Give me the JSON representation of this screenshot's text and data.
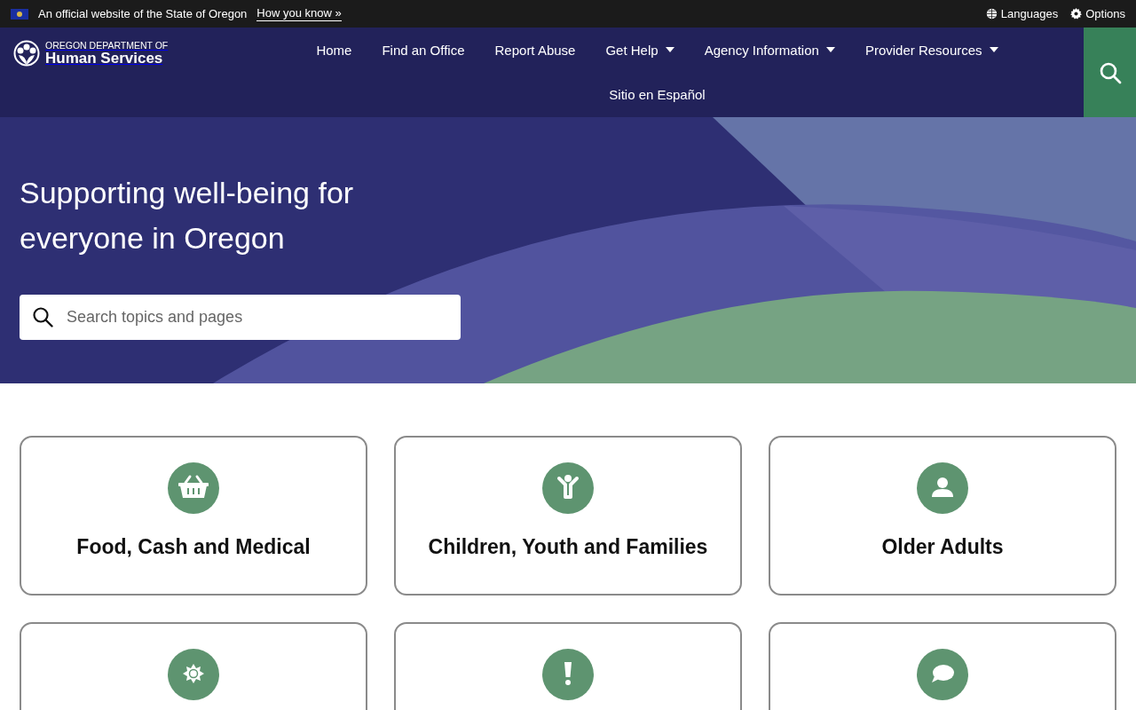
{
  "official_banner": {
    "text": "An official website of the State of Oregon",
    "link": "How you know »"
  },
  "utility_links": [
    {
      "kind": "languages",
      "label": "Languages"
    },
    {
      "kind": "options",
      "label": "Options"
    }
  ],
  "logo": {
    "line_1": "OREGON DEPARTMENT OF",
    "line_2": "Human Services"
  },
  "nav": [
    {
      "label": "Home",
      "dropdown": false
    },
    {
      "label": "Find an Office",
      "dropdown": false
    },
    {
      "label": "Report Abuse",
      "dropdown": false
    },
    {
      "label": "Get Help",
      "dropdown": true
    },
    {
      "label": "Agency Information",
      "dropdown": true
    },
    {
      "label": "Provider Resources",
      "dropdown": true
    },
    {
      "label": "Sitio en Español",
      "dropdown": false
    }
  ],
  "hero": {
    "title": "Supporting well-being for everyone in Oregon",
    "search_placeholder": "Search topics and pages"
  },
  "cards": [
    {
      "kind": "basket",
      "title": "Food, Cash and Medical"
    },
    {
      "kind": "child",
      "title": "Children, Youth and Families"
    },
    {
      "kind": "person",
      "title": "Older Adults"
    },
    {
      "kind": "sun"
    },
    {
      "kind": "exclamation"
    },
    {
      "kind": "speech"
    }
  ]
}
